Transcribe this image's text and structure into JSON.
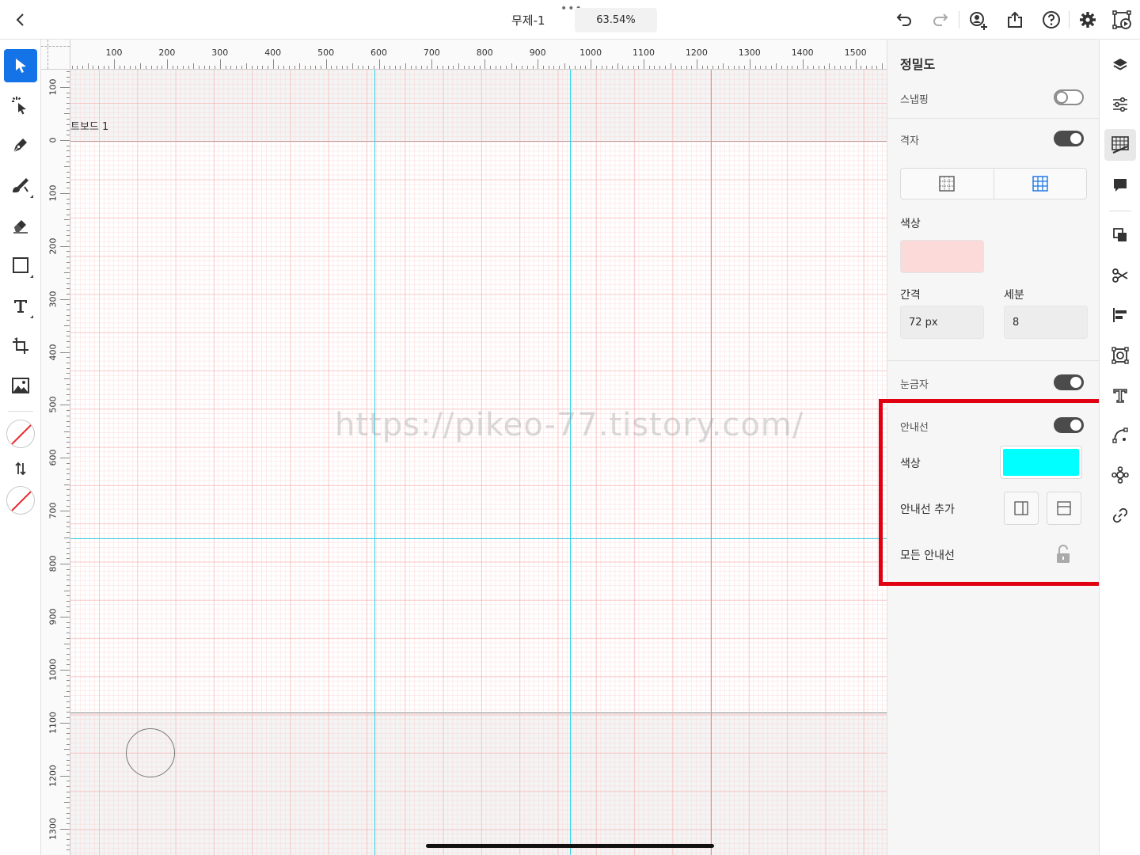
{
  "header": {
    "doc_title": "무제-1",
    "more": "•••",
    "zoom": "63.54%"
  },
  "rulers": {
    "horizontal": [
      "100",
      "200",
      "300",
      "400",
      "500",
      "600",
      "700",
      "800",
      "900",
      "1000",
      "1100",
      "1200",
      "1300",
      "1400",
      "1500"
    ],
    "vertical": [
      "100",
      "0",
      "100",
      "200",
      "300",
      "400",
      "500",
      "600",
      "700",
      "800",
      "900",
      "1000",
      "1100",
      "1200",
      "1300"
    ]
  },
  "canvas": {
    "artboard_label": "트보드 1",
    "watermark": "https://pikeo-77.tistory.com/",
    "guide_color": "#33d2e6"
  },
  "panel": {
    "title": "정밀도",
    "snapping": {
      "label": "스냅핑",
      "on": false
    },
    "grid": {
      "label": "격자",
      "on": true,
      "color_label": "색상",
      "color": "#fcdada",
      "spacing_label": "간격",
      "spacing_value": "72 px",
      "subdivision_label": "세분",
      "subdivision_value": "8"
    },
    "rulers": {
      "label": "눈금자",
      "on": true
    },
    "guides": {
      "label": "안내선",
      "on": true,
      "color_label": "색상",
      "color": "#00ffff",
      "add_label": "안내선 추가",
      "all_label": "모든 안내선"
    },
    "highlight_color": "#e00012"
  }
}
